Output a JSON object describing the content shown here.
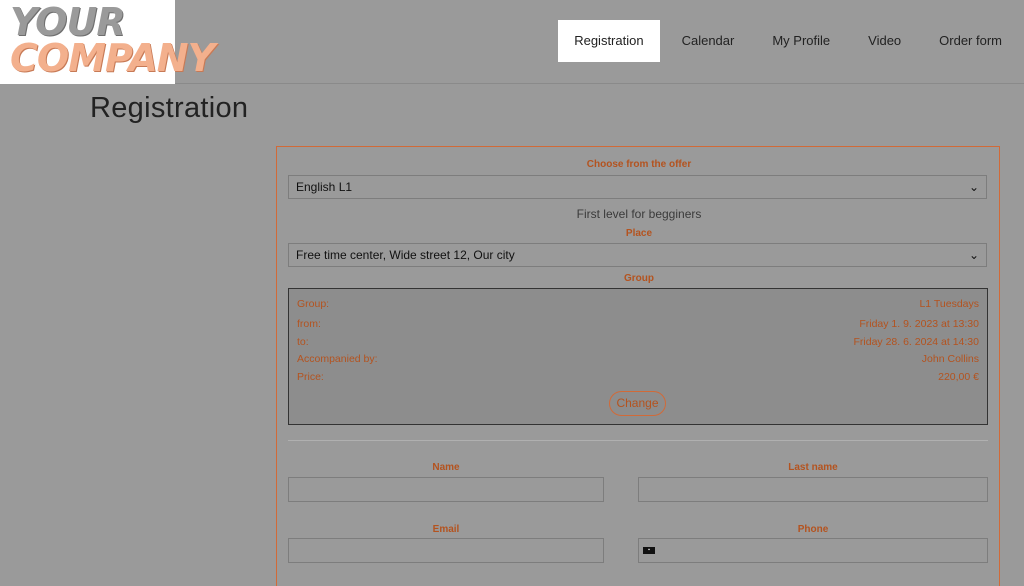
{
  "logo": {
    "line1": "YOUR",
    "line2": "COMPANY"
  },
  "nav": {
    "items": [
      {
        "label": "Registration",
        "active": true
      },
      {
        "label": "Calendar"
      },
      {
        "label": "My Profile"
      },
      {
        "label": "Video"
      },
      {
        "label": "Order form"
      }
    ]
  },
  "page": {
    "title": "Registration"
  },
  "form": {
    "offer_label": "Choose from the offer",
    "offer_value": "English L1",
    "offer_description": "First level for begginers",
    "place_label": "Place",
    "place_value": "Free time center, Wide street 12, Our city",
    "group_label": "Group",
    "group": {
      "rows": [
        {
          "key": "Group:",
          "value": "L1 Tuesdays"
        },
        {
          "key": "from:",
          "value": "Friday 1. 9. 2023 at 13:30"
        },
        {
          "key": "to:",
          "value": "Friday 28. 6. 2024 at 14:30"
        },
        {
          "key": "Accompanied by:",
          "value": "John Collins"
        },
        {
          "key": "Price:",
          "value": "220,00 €"
        }
      ],
      "change_label": "Change"
    },
    "name_label": "Name",
    "lastname_label": "Last name",
    "email_label": "Email",
    "phone_label": "Phone"
  },
  "colors": {
    "accent": "#d16a38",
    "label": "#b4531f",
    "background": "#9a9a9a"
  }
}
